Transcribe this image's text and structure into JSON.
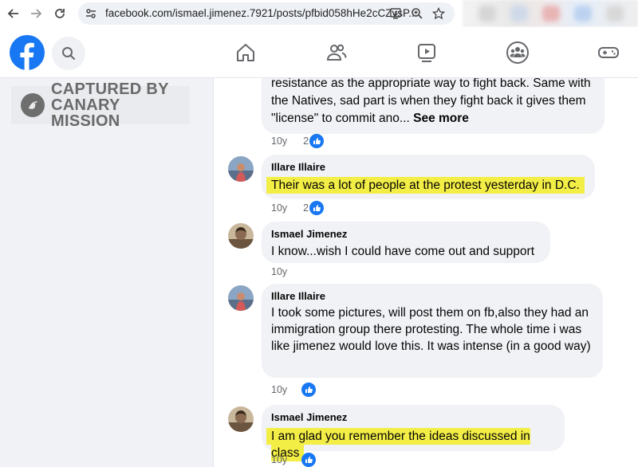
{
  "browser": {
    "url": "facebook.com/ismael.jimenez.7921/posts/pfbid058hHe2cCZvsP..."
  },
  "watermark": {
    "line1": "CAPTURED BY",
    "line2": "CANARY MISSION"
  },
  "colors": {
    "fb_blue": "#1877f2",
    "highlight": "#f3ee46",
    "bubble_bg": "#f0f2f5"
  },
  "comments": [
    {
      "name": "",
      "text": "resistance as the appropriate way to fight back. Same with the Natives, sad part is when they fight back it gives them \"license\" to commit ano...",
      "see_more": "See more",
      "time": "10y",
      "reactions": "2"
    },
    {
      "name": "Illare Illaire",
      "text": "Their was a lot of people at the protest yesterday in D.C.",
      "time": "10y",
      "reactions": "2",
      "highlighted": true
    },
    {
      "name": "Ismael Jimenez",
      "text": "I know...wish I could have come out and support",
      "time": "10y"
    },
    {
      "name": "Illare Illaire",
      "text": "I took some pictures, will post them on fb,also they had an immigration group there protesting. The whole time i was like jimenez would love this. It was intense (in a good way)",
      "time": "10y",
      "reactions": ""
    },
    {
      "name": "Ismael Jimenez",
      "text": "I am glad you remember the ideas discussed in class",
      "time": "10y",
      "reactions": "",
      "highlighted": true
    }
  ]
}
